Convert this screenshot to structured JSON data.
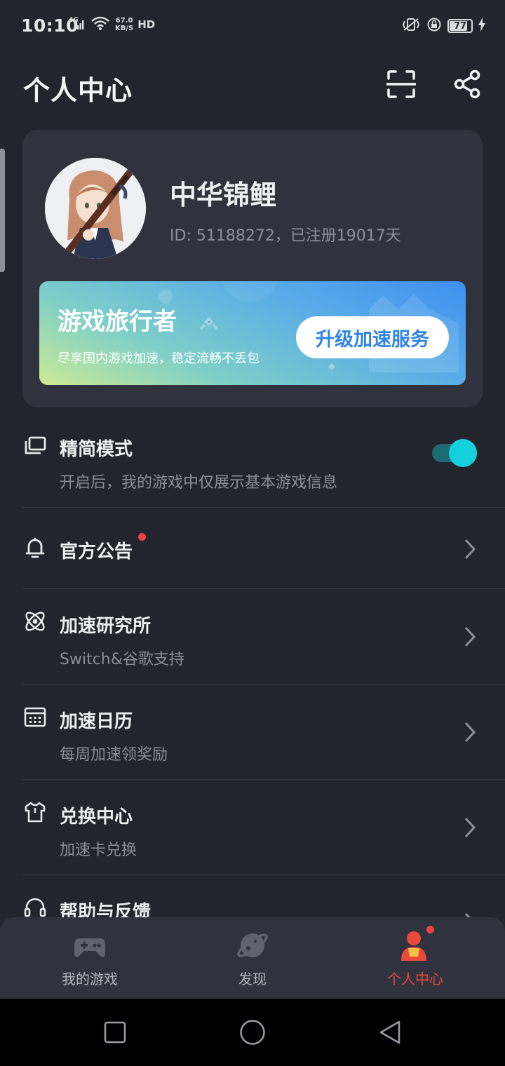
{
  "status_bar": {
    "time": "10:10",
    "network": "4G",
    "speed_value": "67.0",
    "speed_unit": "KB/S",
    "hd": "HD",
    "battery": "77"
  },
  "header": {
    "title": "个人中心",
    "scan_icon": "scan-icon",
    "share_icon": "share-icon"
  },
  "profile": {
    "username": "中华锦鲤",
    "id_text": "ID: 51188272，已注册19017天",
    "avatar": "anime-character-avatar"
  },
  "vip": {
    "title": "游戏旅行者",
    "subtitle": "尽享国内游戏加速，稳定流畅不丢包",
    "button": "升级加速服务"
  },
  "menu": {
    "lite_mode": {
      "title": "精简模式",
      "subtitle": "开启后，我的游戏中仅展示基本游戏信息",
      "enabled": true
    },
    "announcement": {
      "title": "官方公告"
    },
    "lab": {
      "title": "加速研究所",
      "subtitle": "Switch&谷歌支持"
    },
    "calendar": {
      "title": "加速日历",
      "subtitle": "每周加速领奖励"
    },
    "exchange": {
      "title": "兑换中心",
      "subtitle": "加速卡兑换"
    },
    "help": {
      "title": "帮助与反馈"
    }
  },
  "bottom_nav": {
    "tabs": [
      {
        "label": "我的游戏",
        "icon": "gamepad-icon",
        "active": false
      },
      {
        "label": "发现",
        "icon": "planet-icon",
        "active": false
      },
      {
        "label": "个人中心",
        "icon": "person-icon",
        "active": true
      }
    ]
  },
  "colors": {
    "background": "#22252d",
    "card": "#30333d",
    "accent_cyan": "#14d0dc",
    "active_red": "#e94a3c",
    "badge_red": "#f04141"
  }
}
